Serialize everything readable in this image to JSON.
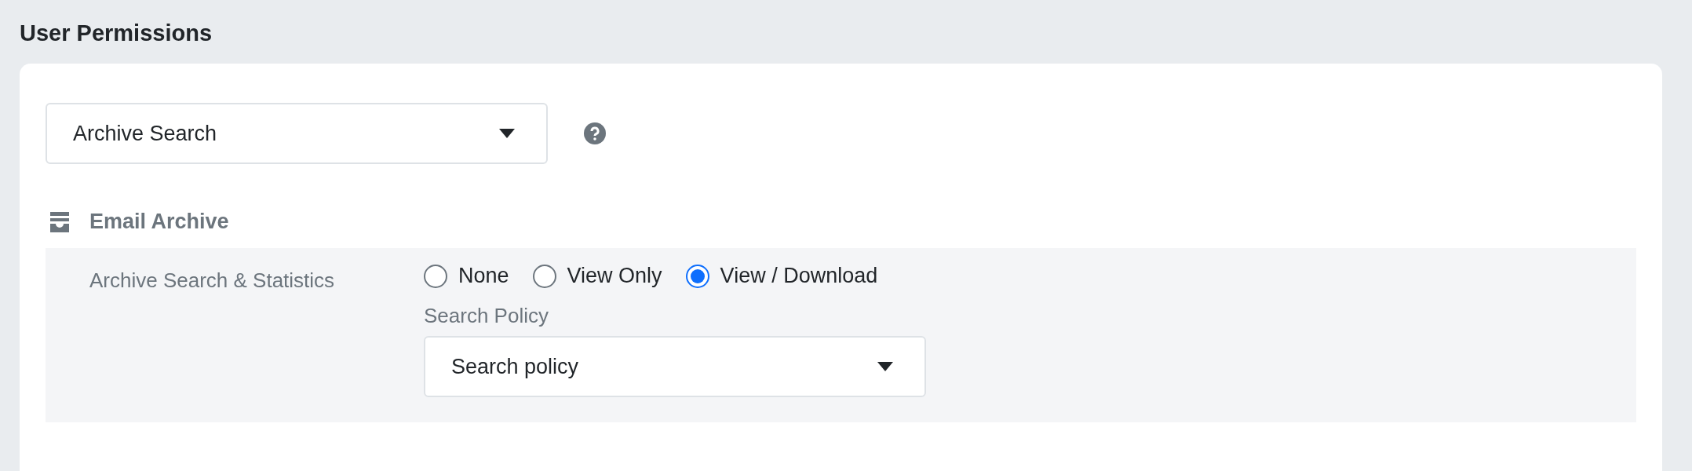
{
  "page_title": "User Permissions",
  "module_select": {
    "value": "Archive Search"
  },
  "section": {
    "title": "Email Archive",
    "rows": [
      {
        "label": "Archive Search & Statistics",
        "options": [
          {
            "label": "None",
            "selected": false
          },
          {
            "label": "View Only",
            "selected": false
          },
          {
            "label": "View / Download",
            "selected": true
          }
        ],
        "policy": {
          "label": "Search Policy",
          "value": "Search policy"
        }
      }
    ]
  }
}
